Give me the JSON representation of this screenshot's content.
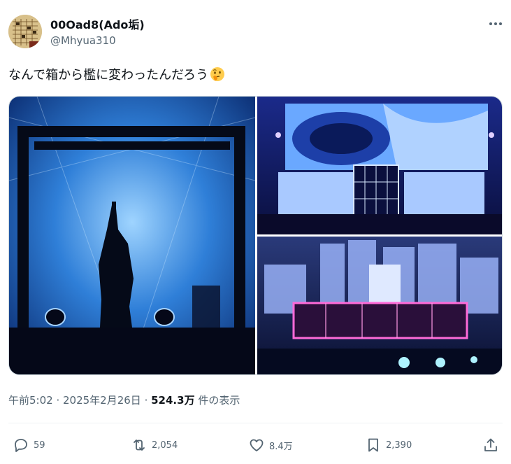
{
  "author": {
    "display_name": "00Oad8(Ado垢)",
    "handle": "@Mhyua310",
    "avatar_icon": "shogi-board-avatar"
  },
  "tweet": {
    "text": "なんで箱から檻に変わったんだろう",
    "emoji": "thinking-face-emoji"
  },
  "media": {
    "images": [
      {
        "icon": "concert-silhouette-in-box-photo"
      },
      {
        "icon": "concert-stage-wide-photo"
      },
      {
        "icon": "concert-city-stage-photo"
      }
    ]
  },
  "meta": {
    "time": "午前5:02",
    "separator": " · ",
    "date": "2025年2月26日",
    "views_count": "524.3万",
    "views_label": " 件の表示"
  },
  "actions": {
    "reply_count": "59",
    "retweet_count": "2,054",
    "like_count": "8.4万",
    "bookmark_count": "2,390"
  },
  "colors": {
    "text_primary": "#0f1419",
    "text_secondary": "#536471",
    "divider": "#eff3f4"
  }
}
